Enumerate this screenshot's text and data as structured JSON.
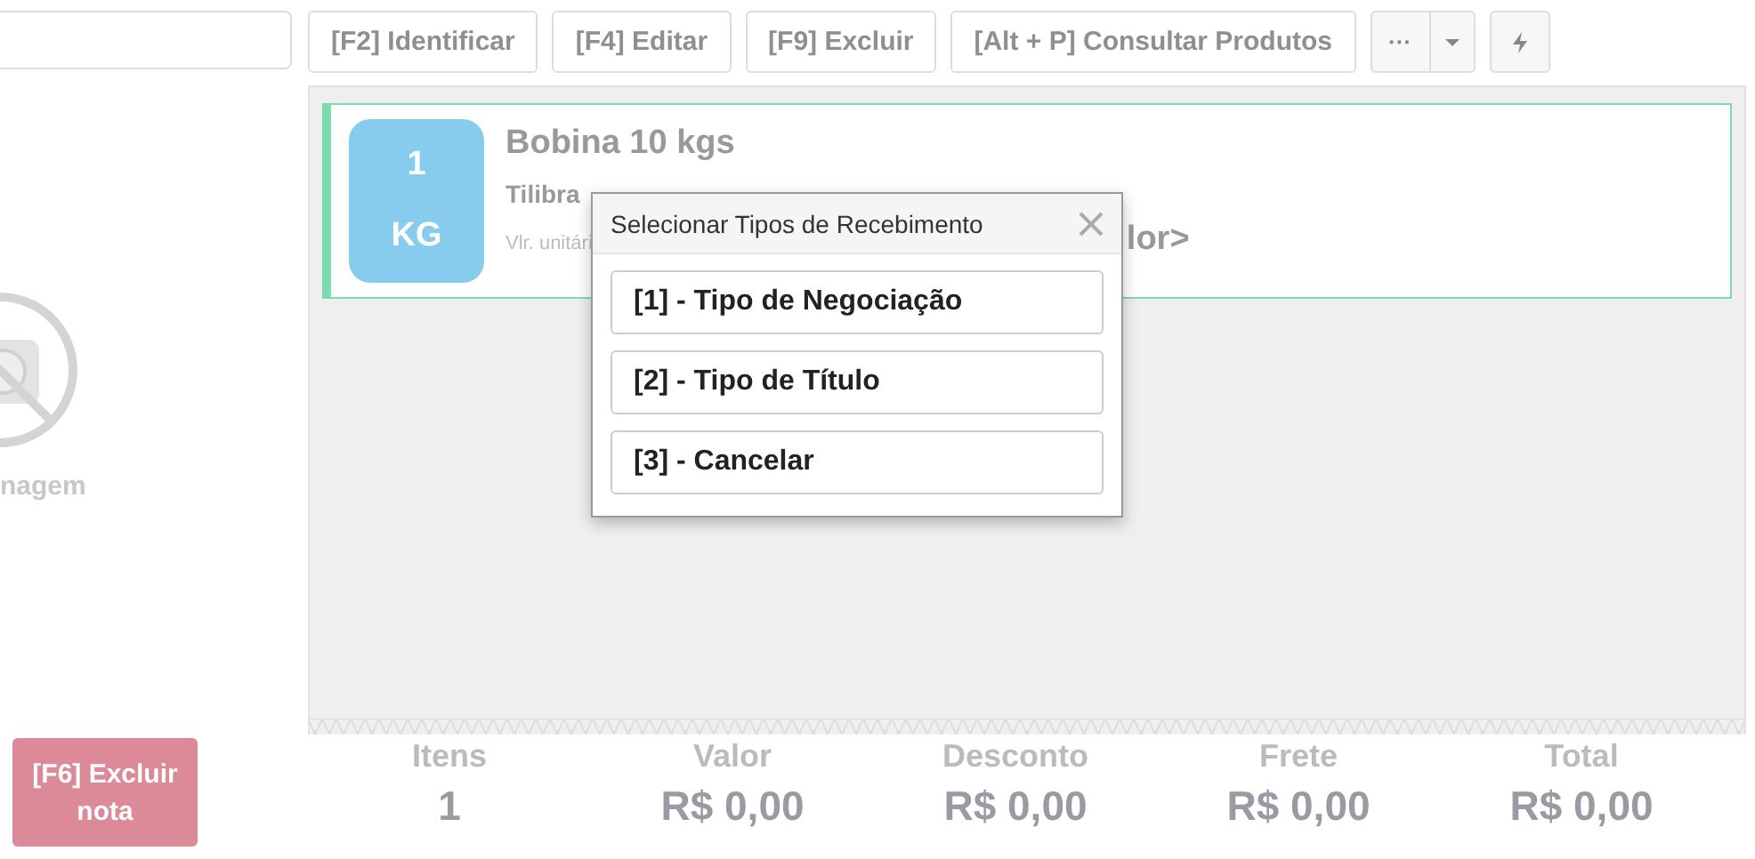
{
  "toolbar": {
    "buttons": [
      {
        "label": "[F2] Identificar"
      },
      {
        "label": "[F4] Editar"
      },
      {
        "label": "[F9] Excluir"
      },
      {
        "label": "[Alt + P] Consultar Produtos"
      }
    ],
    "more": {
      "label": "···"
    }
  },
  "sidebar": {
    "image_caption": "nagem",
    "delete_button": "[F6] Excluir nota"
  },
  "items": [
    {
      "quantity": "1",
      "unit": "KG",
      "name": "Bobina 10 kgs",
      "brand": "Tilibra",
      "unit_price_label": "Vlr. unitári",
      "price": "lor>",
      "selected": true
    }
  ],
  "totals": [
    {
      "label": "Itens",
      "value": "1"
    },
    {
      "label": "Valor",
      "value": "R$ 0,00"
    },
    {
      "label": "Desconto",
      "value": "R$ 0,00"
    },
    {
      "label": "Frete",
      "value": "R$ 0,00"
    },
    {
      "label": "Total",
      "value": "R$ 0,00"
    }
  ],
  "dialog": {
    "title": "Selecionar Tipos de Recebimento",
    "options": [
      "[1] - Tipo de Negociação",
      "[2] - Tipo de Título",
      "[3] - Cancelar"
    ]
  }
}
